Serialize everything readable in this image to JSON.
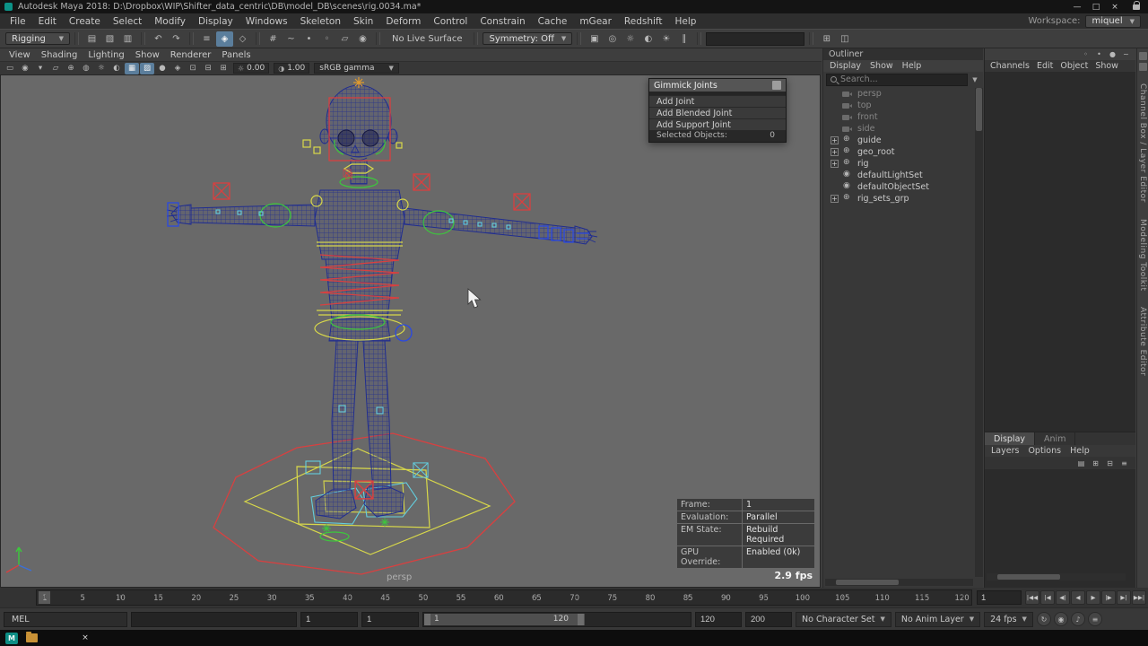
{
  "colors": {
    "accent_blue": "#5b7e9c",
    "viewport_bg": "#696969",
    "wireframe_blue": "#202d90",
    "control_red": "#d84040",
    "control_yellow": "#d8d84a",
    "control_green": "#3cc93c",
    "control_cyan": "#63cede",
    "control_blue": "#2b49e0"
  },
  "titlebar": {
    "title": "Autodesk Maya 2018: D:\\Dropbox\\WIP\\Shifter_data_centric\\DB\\model_DB\\scenes\\rig.0034.ma*",
    "buttons": [
      {
        "name": "minimize-button",
        "glyph": "—"
      },
      {
        "name": "maximize-button",
        "glyph": "□"
      },
      {
        "name": "close-button",
        "glyph": "×"
      }
    ]
  },
  "menubar": {
    "items": [
      "File",
      "Edit",
      "Create",
      "Select",
      "Modify",
      "Display",
      "Windows",
      "Skeleton",
      "Skin",
      "Deform",
      "Control",
      "Constrain",
      "Cache",
      "mGear",
      "Redshift",
      "Help"
    ],
    "workspace_label": "Workspace:",
    "workspace_value": "miquel"
  },
  "statusline": {
    "mode": "Rigging",
    "file_icons": [
      {
        "name": "file-new-icon",
        "glyph": "▤"
      },
      {
        "name": "file-open-icon",
        "glyph": "▧"
      },
      {
        "name": "file-save-icon",
        "glyph": "▥"
      }
    ],
    "undo_icons": [
      {
        "name": "undo-icon",
        "glyph": "↶"
      },
      {
        "name": "redo-icon",
        "glyph": "↷"
      }
    ],
    "select_icons": [
      {
        "name": "select-hierarchy-icon",
        "glyph": "≡"
      },
      {
        "name": "select-object-icon",
        "glyph": "◈",
        "state": "active"
      },
      {
        "name": "select-component-icon",
        "glyph": "◇"
      }
    ],
    "snap_icons": [
      {
        "name": "snap-grid-icon",
        "glyph": "#"
      },
      {
        "name": "snap-curve-icon",
        "glyph": "~"
      },
      {
        "name": "snap-point-icon",
        "glyph": "•"
      },
      {
        "name": "snap-projected-center-icon",
        "glyph": "◦"
      },
      {
        "name": "snap-view-plane-icon",
        "glyph": "▱"
      },
      {
        "name": "make-live-icon",
        "glyph": "◉"
      }
    ],
    "live_surface": "No Live Surface",
    "symmetry": "Symmetry: Off",
    "render_icons": [
      {
        "name": "render-view-icon",
        "glyph": "▣"
      },
      {
        "name": "ipr-render-icon",
        "glyph": "◎"
      },
      {
        "name": "render-settings-icon",
        "glyph": "☼"
      },
      {
        "name": "hypershade-icon",
        "glyph": "◐"
      },
      {
        "name": "light-editor-icon",
        "glyph": "☀"
      },
      {
        "name": "pause-viewport-icon",
        "glyph": "∥"
      }
    ],
    "extra_icons": [
      {
        "name": "toggle-input-icon",
        "glyph": "⊞"
      },
      {
        "name": "counter-icon",
        "glyph": "◫"
      }
    ]
  },
  "viewport": {
    "menu": [
      "View",
      "Shading",
      "Lighting",
      "Show",
      "Renderer",
      "Panels"
    ],
    "toolbar_icons": [
      {
        "name": "camera-lock-icon",
        "glyph": "▭"
      },
      {
        "name": "camera-attributes-icon",
        "glyph": "◉"
      },
      {
        "name": "bookmark-icon",
        "glyph": "▾"
      },
      {
        "name": "image-plane-icon",
        "glyph": "▱"
      },
      {
        "name": "two-d-pan-zoom-icon",
        "glyph": "⊕"
      },
      {
        "name": "oversampling-icon",
        "glyph": "◍"
      },
      {
        "name": "lighting-icon",
        "glyph": "☼"
      },
      {
        "name": "shadows-icon",
        "glyph": "◐"
      },
      {
        "name": "textured-icon",
        "glyph": "▦",
        "state": "active"
      },
      {
        "name": "wireframe-on-shaded-icon",
        "glyph": "▨",
        "state": "active"
      },
      {
        "name": "default-material-icon",
        "glyph": "●"
      },
      {
        "name": "isolate-select-icon",
        "glyph": "◈"
      },
      {
        "name": "resolution-gate-icon",
        "glyph": "⊡"
      },
      {
        "name": "gate-mask-icon",
        "glyph": "⊟"
      },
      {
        "name": "field-chart-icon",
        "glyph": "⊞"
      }
    ],
    "exposure_icon": "☼",
    "exposure": "0.00",
    "gamma_icon": "◑",
    "gamma": "1.00",
    "gamma_mode": "sRGB gamma",
    "camera_label": "persp",
    "hud": {
      "rows": [
        {
          "label": "Frame:",
          "value": "1"
        },
        {
          "label": "Evaluation:",
          "value": "Parallel"
        },
        {
          "label": "EM State:",
          "value": "Rebuild Required"
        },
        {
          "label": "GPU Override:",
          "value": "Enabled (0k)"
        }
      ],
      "fps": "2.9 fps"
    }
  },
  "gimmick": {
    "title": "Gimmick Joints",
    "buttons": [
      "Add Joint",
      "Add Blended Joint",
      "Add Support Joint"
    ],
    "selected_label": "Selected Objects:",
    "selected_value": "0"
  },
  "outliner": {
    "caption": "Outliner",
    "menu": [
      "Display",
      "Show",
      "Help"
    ],
    "search_placeholder": "Search...",
    "items": [
      {
        "label": "persp",
        "icon": "camera",
        "tone": "dim"
      },
      {
        "label": "top",
        "icon": "camera",
        "tone": "dim"
      },
      {
        "label": "front",
        "icon": "camera",
        "tone": "dim"
      },
      {
        "label": "side",
        "icon": "camera",
        "tone": "dim"
      },
      {
        "label": "guide",
        "icon": "transform",
        "expand": true
      },
      {
        "label": "geo_root",
        "icon": "transform",
        "expand": true
      },
      {
        "label": "rig",
        "icon": "transform",
        "expand": true
      },
      {
        "label": "defaultLightSet",
        "icon": "set"
      },
      {
        "label": "defaultObjectSet",
        "icon": "set"
      },
      {
        "label": "rig_sets_grp",
        "icon": "transform",
        "expand": true
      }
    ]
  },
  "channel_box": {
    "menu": [
      "Channels",
      "Edit",
      "Object",
      "Show"
    ],
    "speed_icons": [
      {
        "name": "slow-speed-icon",
        "glyph": "◦"
      },
      {
        "name": "medium-speed-icon",
        "glyph": "•"
      },
      {
        "name": "fast-speed-icon",
        "glyph": "●"
      },
      {
        "name": "hyperbolic-icon",
        "glyph": "~"
      }
    ]
  },
  "layer_editor": {
    "tabs": [
      {
        "label": "Display",
        "state": "active"
      },
      {
        "label": "Anim",
        "state": ""
      }
    ],
    "menu": [
      "Layers",
      "Options",
      "Help"
    ],
    "icons": [
      {
        "name": "layer-visibility-icon",
        "glyph": "▤"
      },
      {
        "name": "add-empty-layer-icon",
        "glyph": "⊞"
      },
      {
        "name": "add-layer-from-selected-icon",
        "glyph": "⊟"
      },
      {
        "name": "layer-options-icon",
        "glyph": "≡"
      }
    ]
  },
  "sidebar": {
    "top_icons": [
      {
        "name": "pin-panel-icon",
        "glyph": ""
      },
      {
        "name": "dock-panel-icon",
        "glyph": ""
      }
    ],
    "tabs": [
      "Channel Box / Layer Editor",
      "Modeling Toolkit",
      "Attribute Editor"
    ]
  },
  "timeline": {
    "ticks": [
      "1",
      "5",
      "10",
      "15",
      "20",
      "25",
      "30",
      "35",
      "40",
      "45",
      "50",
      "55",
      "60",
      "65",
      "70",
      "75",
      "80",
      "85",
      "90",
      "95",
      "100",
      "105",
      "110",
      "115",
      "120"
    ],
    "current": "1",
    "transport": [
      {
        "name": "go-to-start-button",
        "glyph": "|◀◀"
      },
      {
        "name": "step-back-frame-button",
        "glyph": "|◀"
      },
      {
        "name": "step-back-key-button",
        "glyph": "◀|"
      },
      {
        "name": "play-backwards-button",
        "glyph": "◀"
      },
      {
        "name": "play-button",
        "glyph": "▶"
      },
      {
        "name": "step-forward-key-button",
        "glyph": "|▶"
      },
      {
        "name": "step-forward-frame-button",
        "glyph": "▶|"
      },
      {
        "name": "go-to-end-button",
        "glyph": "▶▶|"
      }
    ]
  },
  "range": {
    "start": "1",
    "playback_start": "1",
    "slider_start_label": "1",
    "slider_end_label": "120",
    "playback_end": "120",
    "end": "200",
    "character_set": "No Character Set",
    "anim_layer": "No Anim Layer",
    "fps": "24 fps",
    "right_icons": [
      {
        "name": "playback-loop-icon",
        "glyph": "↻"
      },
      {
        "name": "auto-key-icon",
        "glyph": "◉"
      },
      {
        "name": "mute-sound-icon",
        "glyph": "♪"
      },
      {
        "name": "anim-preferences-icon",
        "glyph": "≡"
      }
    ]
  },
  "command_line": {
    "label": "MEL"
  },
  "taskbar": {
    "maya_glyph": "M",
    "close_glyph": "×"
  }
}
